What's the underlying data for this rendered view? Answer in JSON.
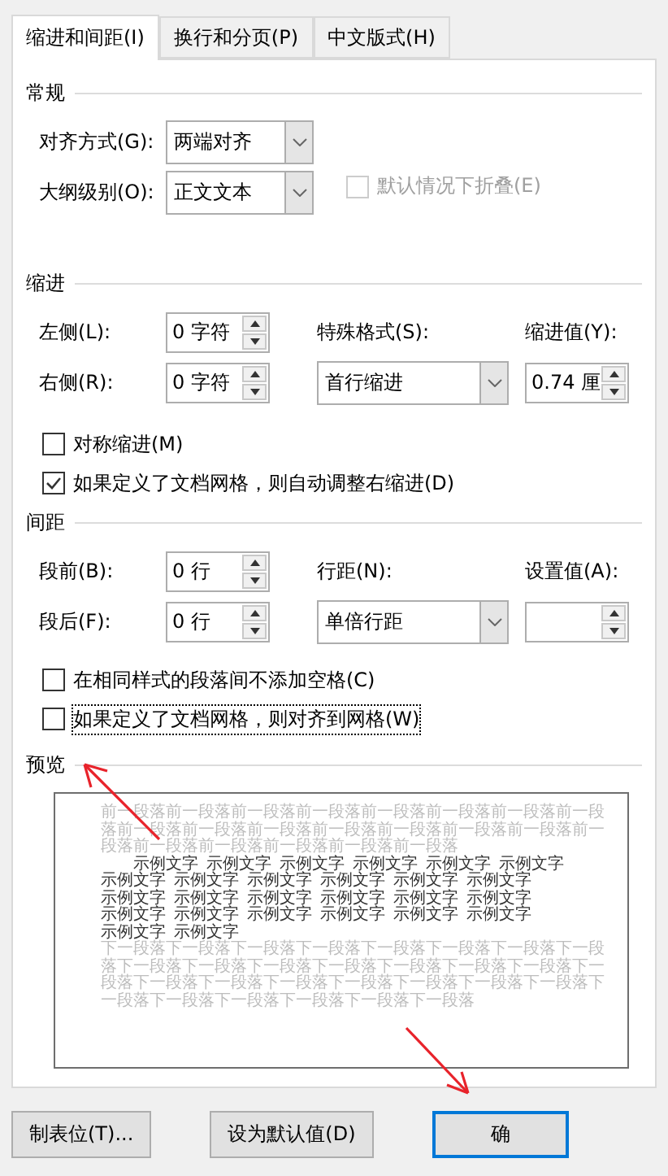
{
  "tabs": [
    {
      "label": "缩进和间距(I)",
      "selected": true
    },
    {
      "label": "换行和分页(P)",
      "selected": false
    },
    {
      "label": "中文版式(H)",
      "selected": false
    }
  ],
  "general": {
    "title": "常规",
    "alignment": {
      "label": "对齐方式(G):",
      "value": "两端对齐"
    },
    "outline_level": {
      "label": "大纲级别(O):",
      "value": "正文文本"
    },
    "collapse": {
      "label": "默认情况下折叠(E)",
      "checked": false,
      "disabled": true
    }
  },
  "indentation": {
    "title": "缩进",
    "left": {
      "label": "左侧(L):",
      "value": "0 字符"
    },
    "right": {
      "label": "右侧(R):",
      "value": "0 字符"
    },
    "special": {
      "label": "特殊格式(S):",
      "value": "首行缩进"
    },
    "by": {
      "label": "缩进值(Y):",
      "value": "0.74 厘"
    },
    "options": [
      {
        "label": "对称缩进(M)",
        "checked": false,
        "focused": false
      },
      {
        "label": "如果定义了文档网格，则自动调整右缩进(D)",
        "checked": true,
        "focused": false
      }
    ]
  },
  "spacing": {
    "title": "间距",
    "before": {
      "label": "段前(B):",
      "value": "0 行"
    },
    "after": {
      "label": "段后(F):",
      "value": "0 行"
    },
    "line_spacing": {
      "label": "行距(N):",
      "value": "单倍行距"
    },
    "at": {
      "label": "设置值(A):"
    },
    "options": [
      {
        "label": "在相同样式的段落间不添加空格(C)",
        "checked": false,
        "focused": false
      },
      {
        "label": "如果定义了文档网格，则对齐到网格(W)",
        "checked": false,
        "focused": true
      }
    ]
  },
  "preview": {
    "title": "预览",
    "previous_text": "前一段落前一段落前一段落前一段落前一段落前一段落前一段落前一段落前一段落前一段落前一段落前一段落前一段落前一段落前一段落前一段落前一段落前一段落前一段落前一段落前一段落",
    "sample_words": [
      "示例文字",
      "示例文字",
      "示例文字",
      "示例文字",
      "示例文字",
      "示例文字",
      "示例文字",
      "示例文字",
      "示例文字",
      "示例文字",
      "示例文字",
      "示例文字",
      "示例文字",
      "示例文字",
      "示例文字",
      "示例文字",
      "示例文字",
      "示例文字",
      "示例文字",
      "示例文字",
      "示例文字",
      "示例文字",
      "示例文字",
      "示例文字",
      "示例文字",
      "示例文字"
    ],
    "next_text": "下一段落下一段落下一段落下一段落下一段落下一段落下一段落下一段落下一段落下一段落下一段落下一段落下一段落下一段落下一段落下一段落下一段落下一段落下一段落下一段落下一段落下一段落下一段落下一段落下一段落下一段落下一段落下一段落下一段落"
  },
  "buttons": [
    {
      "label": "制表位(T)...",
      "default": false
    },
    {
      "label": "设为默认值(D)",
      "default": false
    },
    {
      "label": "确",
      "default": true
    }
  ]
}
